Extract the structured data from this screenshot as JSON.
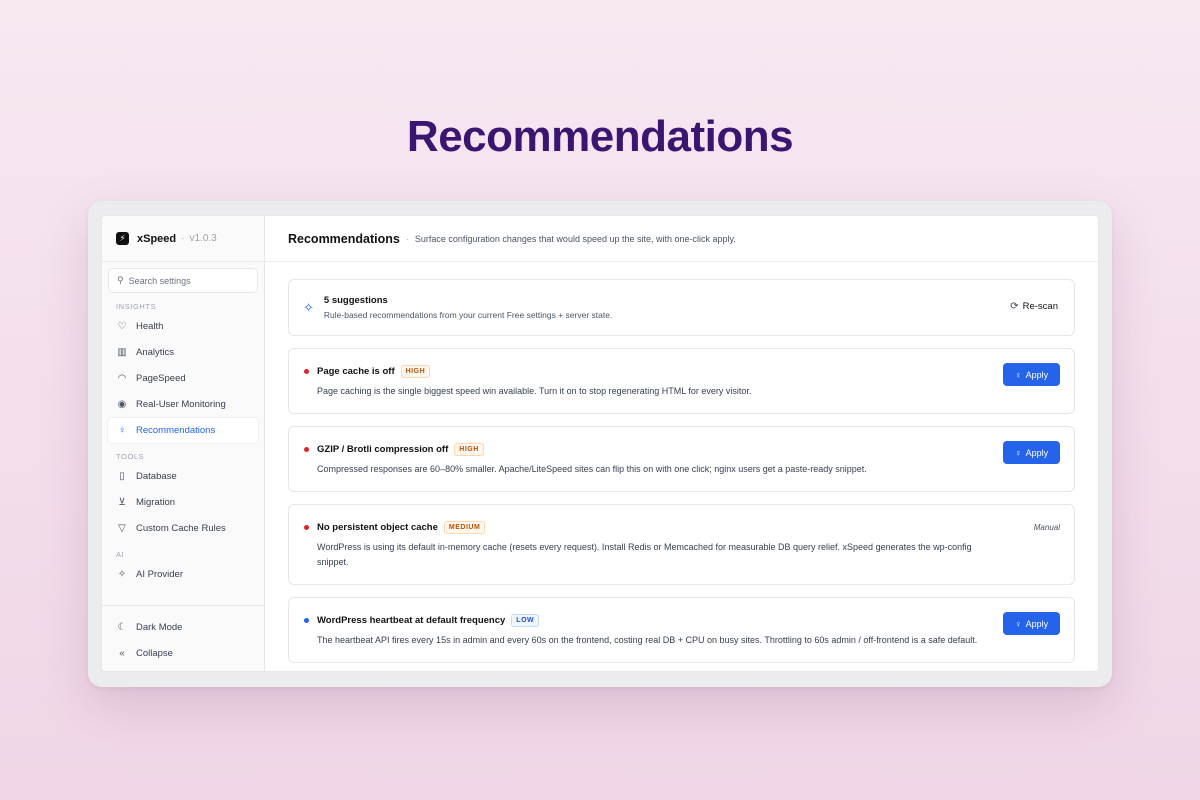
{
  "hero": {
    "title": "Recommendations"
  },
  "brand": {
    "name": "xSpeed",
    "version": "v1.0.3"
  },
  "search": {
    "placeholder": "Search settings"
  },
  "sidebar": {
    "sections": [
      {
        "label": "INSIGHTS",
        "items": [
          {
            "label": "Health",
            "icon": "heart-pulse-icon"
          },
          {
            "label": "Analytics",
            "icon": "bar-chart-icon"
          },
          {
            "label": "PageSpeed",
            "icon": "gauge-icon"
          },
          {
            "label": "Real-User Monitoring",
            "icon": "eye-icon"
          },
          {
            "label": "Recommendations",
            "icon": "lightbulb-icon",
            "active": true
          }
        ]
      },
      {
        "label": "TOOLS",
        "items": [
          {
            "label": "Database",
            "icon": "trash-icon"
          },
          {
            "label": "Migration",
            "icon": "download-box-icon"
          },
          {
            "label": "Custom Cache Rules",
            "icon": "filter-icon"
          }
        ]
      },
      {
        "label": "AI",
        "items": [
          {
            "label": "AI Provider",
            "icon": "sparkles-icon"
          }
        ]
      }
    ],
    "bottom": [
      {
        "label": "Dark Mode",
        "icon": "moon-icon"
      },
      {
        "label": "Collapse",
        "icon": "chevrons-left-icon"
      }
    ]
  },
  "header": {
    "title": "Recommendations",
    "subtitle": "Surface configuration changes that would speed up the site, with one-click apply."
  },
  "summary": {
    "title": "5 suggestions",
    "subtitle": "Rule-based recommendations from your current Free settings + server state.",
    "rescan_label": "Re-scan"
  },
  "recommendations": [
    {
      "title": "Page cache is off",
      "severity": "HIGH",
      "dot_color": "#dc2626",
      "description": "Page caching is the single biggest speed win available. Turn it on to stop regenerating HTML for every visitor.",
      "action": "Apply"
    },
    {
      "title": "GZIP / Brotli compression off",
      "severity": "HIGH",
      "dot_color": "#dc2626",
      "description": "Compressed responses are 60–80% smaller. Apache/LiteSpeed sites can flip this on with one click; nginx users get a paste-ready snippet.",
      "action": "Apply"
    },
    {
      "title": "No persistent object cache",
      "severity": "MEDIUM",
      "dot_color": "#dc2626",
      "description": "WordPress is using its default in-memory cache (resets every request). Install Redis or Memcached for measurable DB query relief. xSpeed generates the wp-config snippet.",
      "action": "Manual"
    },
    {
      "title": "WordPress heartbeat at default frequency",
      "severity": "LOW",
      "dot_color": "#2563eb",
      "description": "The heartbeat API fires every 15s in admin and every 60s on the frontend, costing real DB + CPU on busy sites. Throttling to 60s admin / off-frontend is a safe default.",
      "action": "Apply"
    }
  ],
  "colors": {
    "accent": "#2563eb",
    "hero": "#3b1670",
    "high": "#dc2626",
    "low": "#2563eb"
  }
}
